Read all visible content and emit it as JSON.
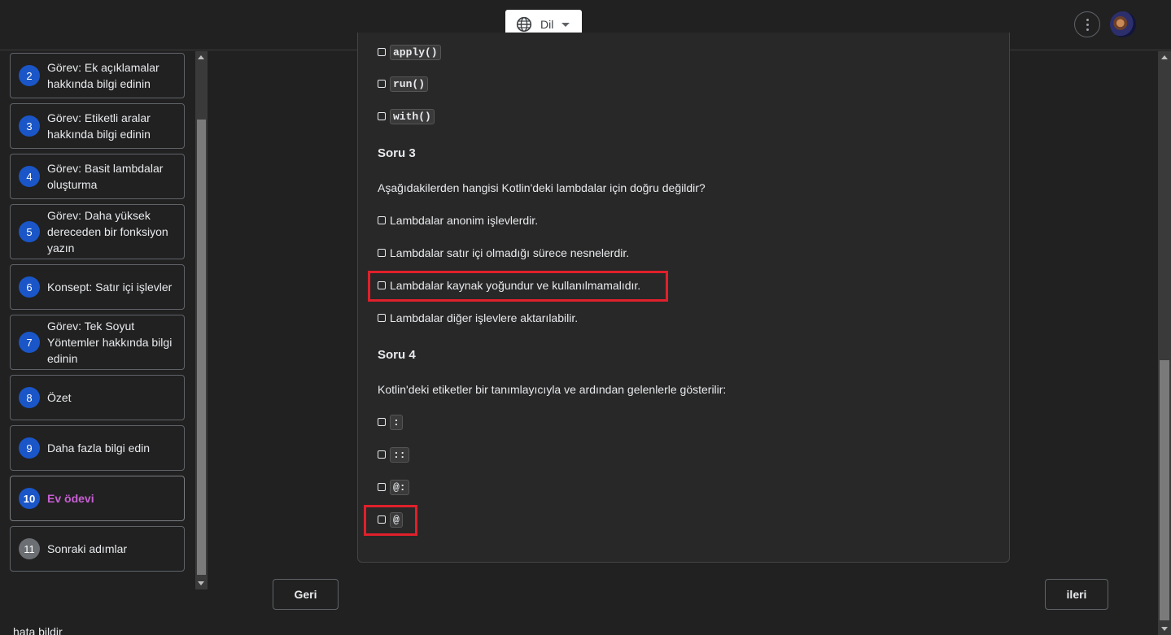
{
  "header": {
    "language_label": "Dil",
    "language_icon": "globe-icon",
    "menu_icon": "more-vert-icon",
    "avatar_icon": "user-avatar"
  },
  "sidebar": {
    "items": [
      {
        "number": "2",
        "label": "Görev: Ek açıklamalar hakkında bilgi edinin"
      },
      {
        "number": "3",
        "label": "Görev: Etiketli aralar hakkında bilgi edinin"
      },
      {
        "number": "4",
        "label": "Görev: Basit lambdalar oluşturma"
      },
      {
        "number": "5",
        "label": "Görev: Daha yüksek dereceden bir fonksiyon yazın"
      },
      {
        "number": "6",
        "label": "Konsept: Satır içi işlevler"
      },
      {
        "number": "7",
        "label": "Görev: Tek Soyut Yöntemler hakkında bilgi edinin"
      },
      {
        "number": "8",
        "label": "Özet"
      },
      {
        "number": "9",
        "label": "Daha fazla bilgi edin"
      },
      {
        "number": "10",
        "label": "Ev ödevi",
        "active": true
      },
      {
        "number": "11",
        "label": "Sonraki adımlar"
      }
    ]
  },
  "content": {
    "q2_options": [
      "apply()",
      "run()",
      "with()"
    ],
    "q3": {
      "title": "Soru 3",
      "question": "Aşağıdakilerden hangisi Kotlin'deki lambdalar için doğru değildir?",
      "options": [
        "Lambdalar anonim işlevlerdir.",
        "Lambdalar satır içi olmadığı sürece nesnelerdir.",
        "Lambdalar kaynak yoğundur ve kullanılmamalıdır.",
        "Lambdalar diğer işlevlere aktarılabilir."
      ]
    },
    "q4": {
      "title": "Soru 4",
      "question": "Kotlin'deki etiketler bir tanımlayıcıyla ve ardından gelenlerle gösterilir:",
      "options": [
        ":",
        "::",
        "@:",
        "@"
      ]
    }
  },
  "nav": {
    "back_label": "Geri",
    "next_label": "ileri"
  },
  "footer": {
    "report_label": "hata bildir"
  },
  "colors": {
    "highlight": "#e0202b",
    "active_step": "#c85fd4",
    "step_badge": "#1a56c8"
  }
}
